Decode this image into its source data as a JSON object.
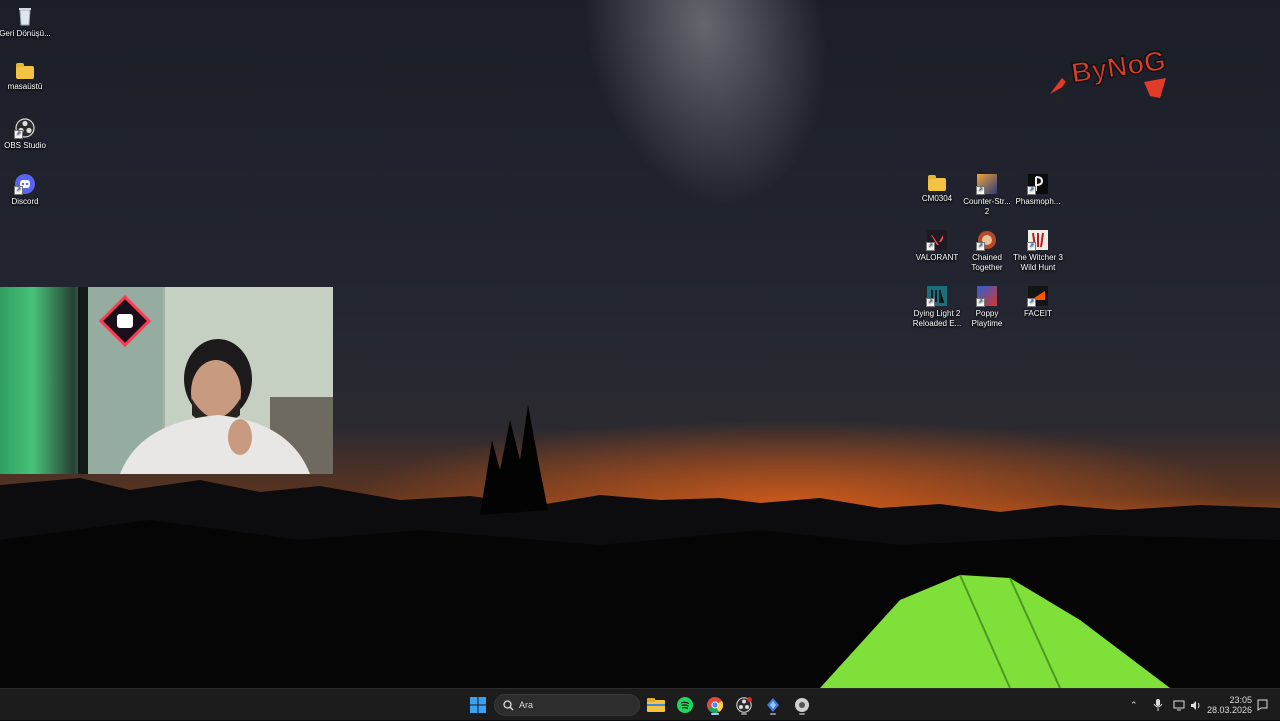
{
  "desktop_left": [
    {
      "label": "Geri Dönüşü...",
      "icon": "recycle-bin-icon"
    },
    {
      "label": "masaüstü",
      "icon": "folder-icon"
    },
    {
      "label": "OBS Studio",
      "icon": "obs-icon"
    },
    {
      "label": "Discord",
      "icon": "discord-icon"
    }
  ],
  "desktop_right": [
    {
      "label": "CM0304",
      "icon": "folder-icon"
    },
    {
      "label": "Counter-Str... 2",
      "icon": "counter-strike-icon"
    },
    {
      "label": "Phasmoph...",
      "icon": "phasmophobia-icon"
    },
    {
      "label": "VALORANT",
      "icon": "valorant-icon"
    },
    {
      "label": "Chained Together",
      "icon": "chained-together-icon"
    },
    {
      "label": "The Witcher 3 Wild Hunt",
      "icon": "witcher-icon"
    },
    {
      "label": "Dying Light 2 Reloaded E...",
      "icon": "dying-light-icon"
    },
    {
      "label": "Poppy Playtime",
      "icon": "poppy-playtime-icon"
    },
    {
      "label": "FACEIT",
      "icon": "faceit-icon"
    }
  ],
  "logo_text": "ByNoG",
  "taskbar": {
    "search_placeholder": "Ara",
    "apps": [
      "start-icon",
      "file-explorer-icon",
      "spotify-icon",
      "chrome-icon",
      "obs-icon",
      "app-icon",
      "settings-icon"
    ],
    "clock_time": "23:05",
    "clock_date": "28.03.2026"
  },
  "colors": {
    "taskbar": "#1c1c1c",
    "tent": "#7fe03a",
    "horizon": "#e0621c"
  }
}
